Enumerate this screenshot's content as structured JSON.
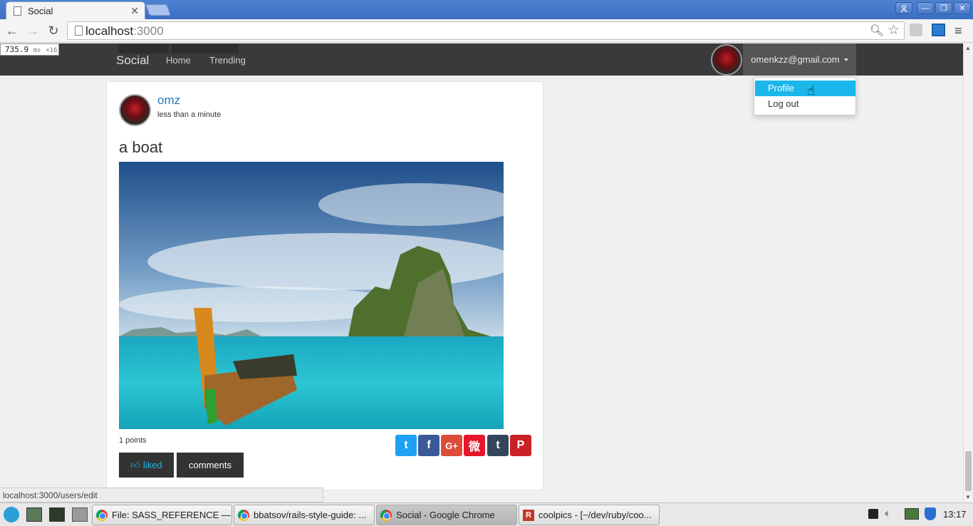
{
  "browser": {
    "tab_title": "Social",
    "url_host": "localhost",
    "url_port": ":3000",
    "status_url": "localhost:3000/users/edit",
    "timing_value": "735.9",
    "timing_unit": "ms",
    "timing_multiplier": "×16"
  },
  "navbar": {
    "brand": "Social",
    "links": [
      "Home",
      "Trending"
    ],
    "user_email": "omenkzz@gmail.com"
  },
  "dropdown": {
    "items": [
      "Profile",
      "Log out"
    ]
  },
  "post": {
    "author": "omz",
    "time": "less than a minute",
    "title": "a boat",
    "points": "1 points",
    "liked_label": "liked",
    "comments_label": "comments",
    "share_icons": [
      "twitter-icon",
      "facebook-icon",
      "google-plus-icon",
      "weibo-icon",
      "tumblr-icon",
      "pinterest-icon"
    ],
    "share_colors": [
      "#1da1f2",
      "#3b5998",
      "#dd4b39",
      "#e6162d",
      "#35465c",
      "#cb2027"
    ]
  },
  "taskbar": {
    "tasks": [
      "File: SASS_REFERENCE — ...",
      "bbatsov/rails-style-guide: ...",
      "Social - Google Chrome",
      "coolpics - [~/dev/ruby/coo..."
    ],
    "clock": "13:17"
  }
}
